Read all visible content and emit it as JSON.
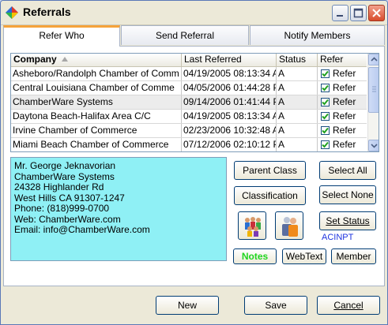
{
  "window": {
    "title": "Referrals"
  },
  "tabs": [
    {
      "label": "Refer Who"
    },
    {
      "label": "Send Referral"
    },
    {
      "label": "Notify Members"
    }
  ],
  "grid": {
    "columns": [
      "Company",
      "Last Referred",
      "Status",
      "Refer"
    ],
    "rows": [
      {
        "company": "Asheboro/Randolph Chamber of Comm",
        "last": "04/19/2005 08:13:34 A",
        "status": "A",
        "checked": true,
        "refer": "Refer"
      },
      {
        "company": "Central Louisiana Chamber of Comme",
        "last": "04/05/2006 01:44:28 P",
        "status": "A",
        "checked": true,
        "refer": "Refer"
      },
      {
        "company": "ChamberWare Systems",
        "last": "09/14/2006 01:41:44 P",
        "status": "A",
        "checked": true,
        "refer": "Refer"
      },
      {
        "company": "Daytona Beach-Halifax Area C/C",
        "last": "04/19/2005 08:13:34 A",
        "status": "A",
        "checked": true,
        "refer": "Refer"
      },
      {
        "company": "Irvine Chamber of Commerce",
        "last": "02/23/2006 10:32:48 A",
        "status": "A",
        "checked": true,
        "refer": "Refer"
      },
      {
        "company": "Miami Beach Chamber of Commerce",
        "last": "07/12/2006 02:10:12 P",
        "status": "A",
        "checked": true,
        "refer": "Refer"
      }
    ]
  },
  "info": {
    "lines": [
      "Mr. George Jeknavorian",
      "ChamberWare Systems",
      "24328 Highlander Rd",
      "West Hills CA 91307-1247",
      "Phone: (818)999-0700",
      "Web: ChamberWare.com",
      "Email: info@ChamberWare.com"
    ]
  },
  "buttons": {
    "parent_class": "Parent Class",
    "classification": "Classification",
    "select_all": "Select All",
    "select_none": "Select None",
    "set_status": "Set Status",
    "status_code": "ACINPT",
    "notes": "Notes",
    "webtext": "WebText",
    "member": "Member",
    "new": "New",
    "save": "Save",
    "cancel": "Cancel"
  },
  "colors": {
    "notes_text": "#1fd61f",
    "info_background": "#8ff0f5",
    "active_tab_accent": "#f5a33b",
    "status_code_text": "#1d33e0"
  }
}
